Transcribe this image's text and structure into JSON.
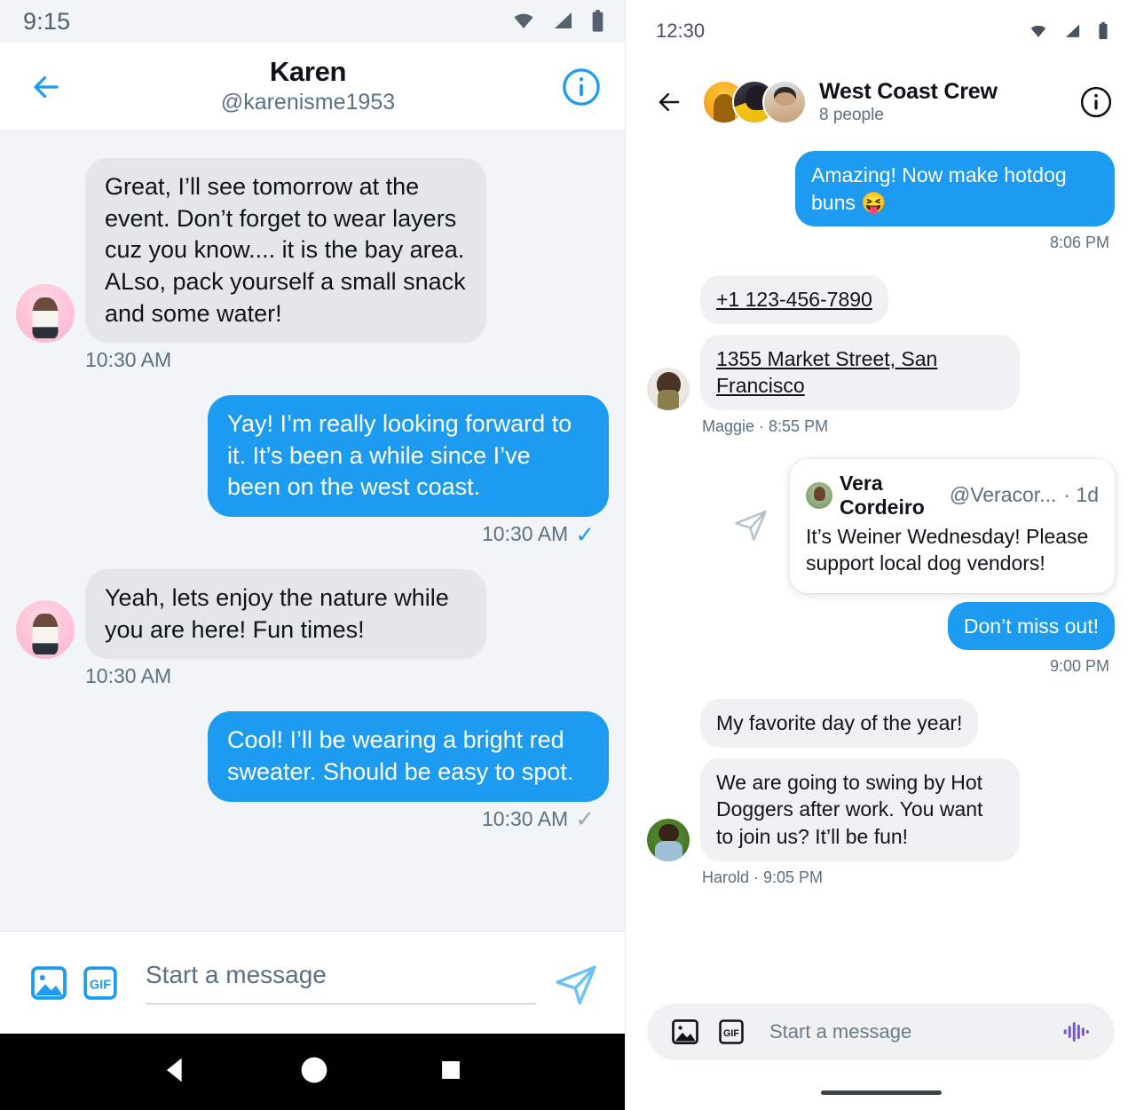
{
  "left": {
    "status": {
      "time": "9:15",
      "icons": [
        "wifi-icon",
        "signal-icon",
        "battery-icon"
      ]
    },
    "header": {
      "back_icon": "back-arrow-icon",
      "name": "Karen",
      "handle": "@karenisme1953",
      "info_icon": "info-icon"
    },
    "messages": [
      {
        "direction": "in",
        "text": "Great, I’ll see tomorrow at the event. Don’t forget to wear layers cuz you know.... it is the bay area. ALso, pack yourself a small snack and some water!",
        "time": "10:30 AM",
        "avatar": "karen-avatar"
      },
      {
        "direction": "out",
        "text": "Yay! I’m really looking forward to it. It’s been a while since I’ve been on the west coast.",
        "time": "10:30 AM",
        "status": "read"
      },
      {
        "direction": "in",
        "text": "Yeah, lets enjoy the nature while you are here! Fun times!",
        "time": "10:30 AM",
        "avatar": "karen-avatar"
      },
      {
        "direction": "out",
        "text": "Cool! I’ll be wearing a bright red sweater. Should be easy to spot.",
        "time": "10:30 AM",
        "status": "sent"
      }
    ],
    "composer": {
      "image_icon": "image-icon",
      "gif_icon": "gif-icon",
      "placeholder": "Start a message",
      "value": "",
      "send_icon": "send-icon"
    },
    "navbar": {
      "back_icon": "nav-back-triangle-icon",
      "home_icon": "nav-home-circle-icon",
      "recents_icon": "nav-recents-square-icon"
    }
  },
  "right": {
    "status": {
      "time": "12:30",
      "icons": [
        "wifi-icon",
        "signal-icon",
        "battery-icon"
      ]
    },
    "header": {
      "back_icon": "back-arrow-icon",
      "group_name": "West Coast Crew",
      "member_count": "8 people",
      "info_icon": "info-icon"
    },
    "messages": [
      {
        "direction": "out",
        "text": "Amazing! Now make hotdog buns 😝",
        "time": "8:06 PM"
      },
      {
        "direction": "in",
        "text": "+1 123-456-7890",
        "link": true,
        "sender": "Maggie"
      },
      {
        "direction": "in",
        "text": "1355 Market Street, San Francisco",
        "link": true,
        "sender": "Maggie",
        "time": "8:55 PM",
        "meta": "Maggie · 8:55 PM"
      },
      {
        "direction": "out",
        "type": "quote-tweet",
        "share_icon": "share-send-icon",
        "quote": {
          "author": "Vera Cordeiro",
          "handle": "@Veracor...",
          "age": "· 1d",
          "body": "It’s Weiner Wednesday! Please support local dog vendors!"
        }
      },
      {
        "direction": "out",
        "text": "Don’t miss out!",
        "time": "9:00 PM"
      },
      {
        "direction": "in",
        "text": "My favorite day of the year!",
        "sender": "Harold"
      },
      {
        "direction": "in",
        "text": "We are going to swing by Hot Doggers after work. You want to join us? It’ll be fun!",
        "sender": "Harold",
        "meta": "Harold · 9:05 PM"
      }
    ],
    "composer": {
      "image_icon": "image-icon",
      "gif_icon": "gif-icon",
      "placeholder": "Start a message",
      "value": "",
      "audio_icon": "audio-waveform-icon"
    }
  },
  "colors": {
    "accent_blue": "#1d9bf0",
    "bubble_in_left": "#e4e7e9",
    "bubble_in_right": "#eff1f2",
    "text_primary": "#0f1419",
    "text_secondary": "#5b7083",
    "left_bg": "#f2f5f7",
    "audio_purple": "#7856c7"
  }
}
